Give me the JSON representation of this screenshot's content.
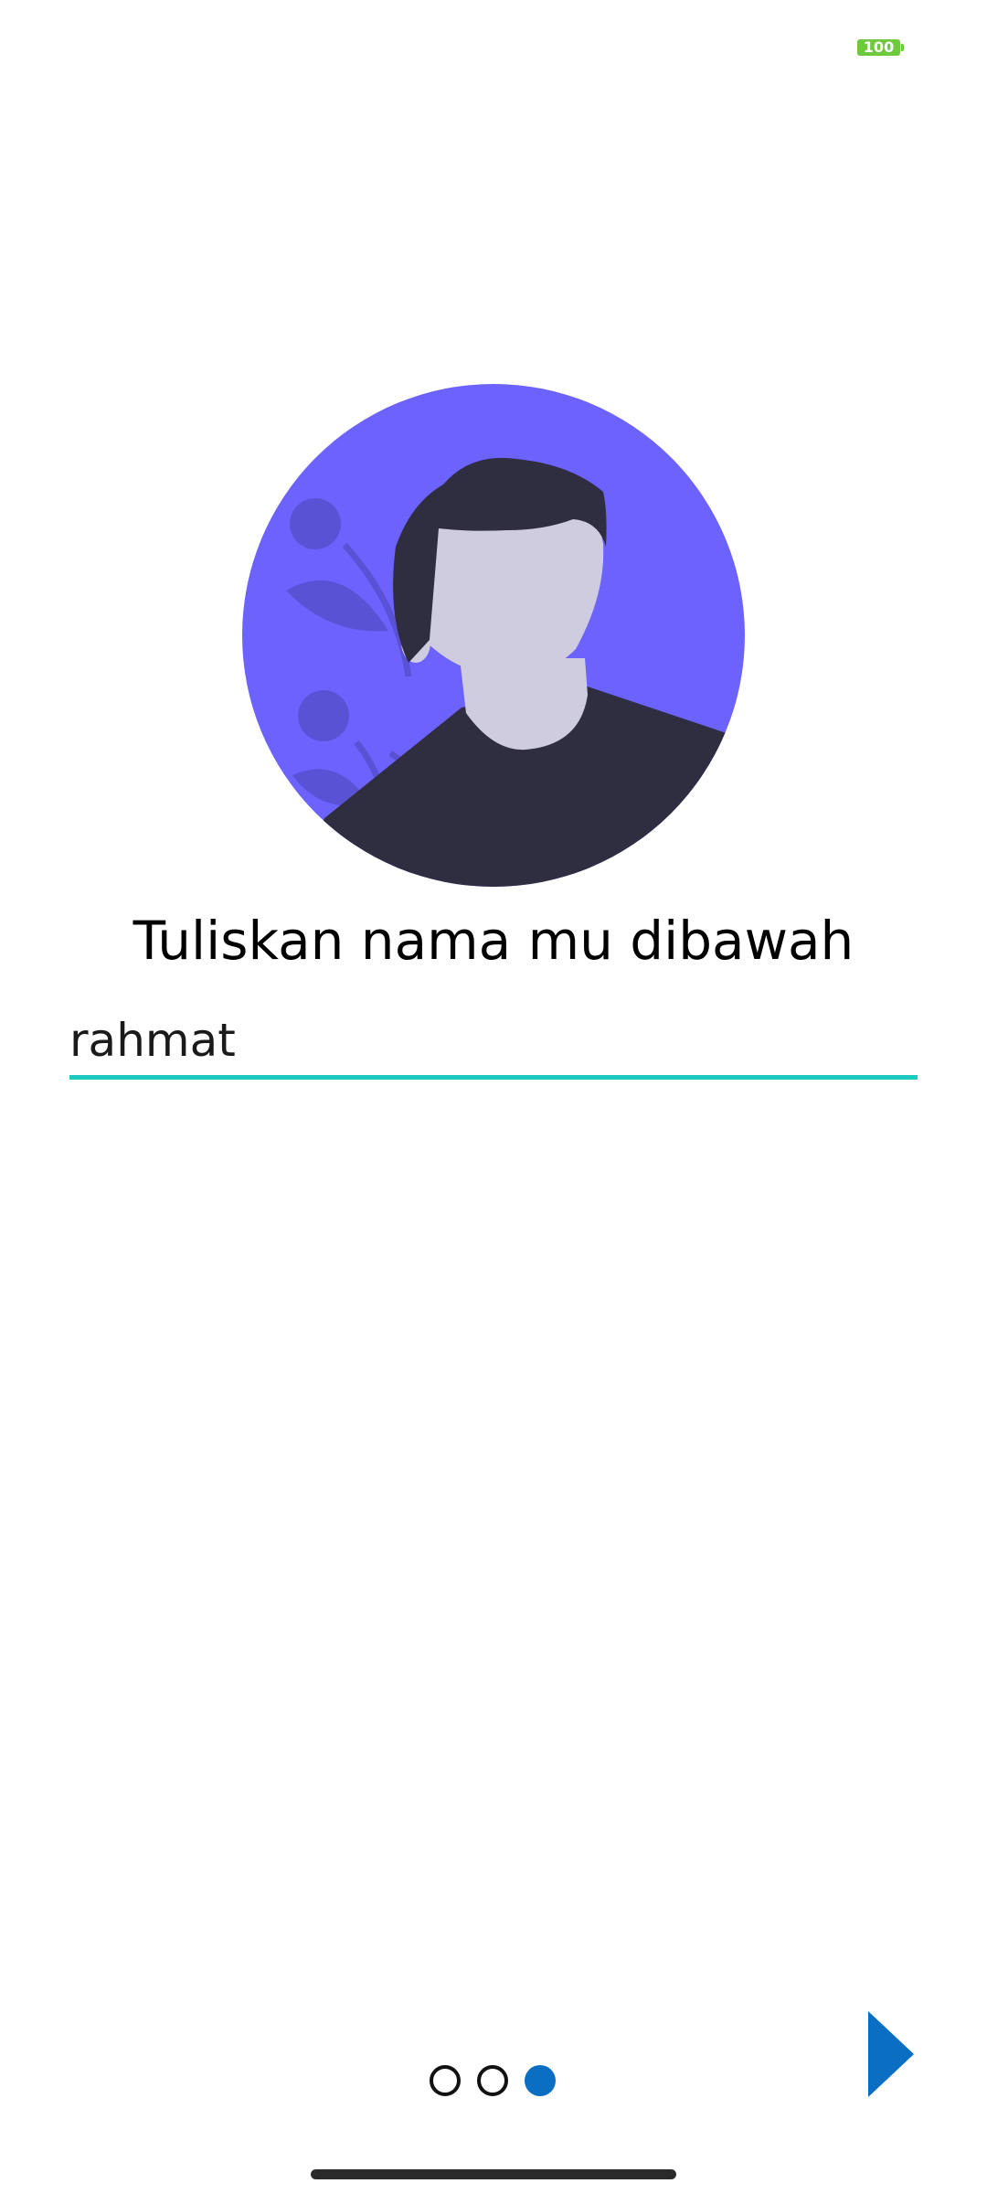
{
  "status_bar": {
    "battery_level": "100",
    "battery_color": "#6ec93d"
  },
  "avatar": {
    "icon": "person-avatar-illustration",
    "background_color": "#6c63ff"
  },
  "title": "Tuliskan nama mu dibawah",
  "name_input": {
    "value": "rahmat",
    "underline_color": "#1cc9c1"
  },
  "pager": {
    "total_pages": 3,
    "current_page": 3,
    "active_color": "#0a6fc2"
  },
  "next_button": {
    "icon": "play-arrow-icon",
    "color": "#0a6fc2"
  }
}
